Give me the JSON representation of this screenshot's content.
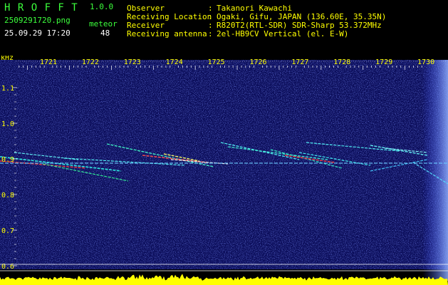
{
  "app": {
    "name": "H R O F F T",
    "version": "1.0.0"
  },
  "file": {
    "name": "2509291720.png",
    "datetime": "25.09.29 17:20"
  },
  "detection": {
    "label": "meteor",
    "count": "48"
  },
  "info": [
    {
      "key": "Observer",
      "sep": ":",
      "value": "Takanori Kawachi"
    },
    {
      "key": "Receiving Location",
      "sep": ":",
      "value": "Ogaki, Gifu, JAPAN (136.60E, 35.35N)"
    },
    {
      "key": "Receiver",
      "sep": ":",
      "value": "R820T2(RTL-SDR) SDR-Sharp 53.372MHz"
    },
    {
      "key": "Receiving antenna",
      "sep": ":",
      "value": "2el-HB9CV Vertical (el. E-W)"
    }
  ],
  "chart_data": {
    "type": "heatmap",
    "ylabel": "kHz",
    "time_ticks": [
      "1721",
      "1722",
      "1723",
      "1724",
      "1725",
      "1726",
      "1727",
      "1728",
      "1729",
      "1730"
    ],
    "freq_ticks": [
      "1.1",
      "1.0",
      "0.9",
      "0.8",
      "0.7",
      "0.6"
    ],
    "ylim": [
      0.59,
      1.19
    ],
    "carrier_khz": 0.9,
    "colors": {
      "background": "#000000",
      "noise": "#2630b0",
      "signal": "#00ffff",
      "hot": "#ff3030",
      "text": "#ffff00",
      "histogram": "#ffff00"
    }
  }
}
